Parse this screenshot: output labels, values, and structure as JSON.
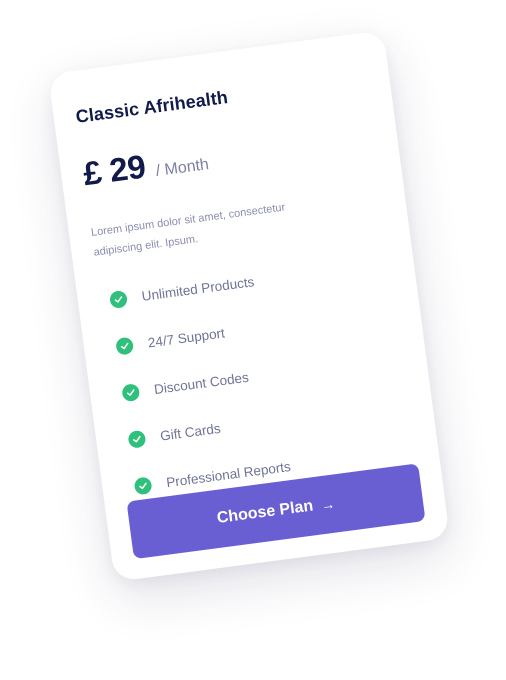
{
  "card": {
    "title": "Classic Afrihealth",
    "price": "£ 29",
    "period": "/ Month",
    "description": "Lorem ipsum dolor sit amet, consectetur adipiscing elit. Ipsum.",
    "features": [
      {
        "label": "Unlimited Products",
        "icon": "check-circle-icon"
      },
      {
        "label": "24/7 Support",
        "icon": "check-circle-icon"
      },
      {
        "label": "Discount Codes",
        "icon": "check-circle-icon"
      },
      {
        "label": "Gift Cards",
        "icon": "check-circle-icon"
      },
      {
        "label": "Professional Reports",
        "icon": "check-circle-icon"
      }
    ],
    "cta": {
      "label": "Choose Plan",
      "arrow": "→",
      "icon": "arrow-right-icon"
    }
  },
  "colors": {
    "title": "#121a4a",
    "muted": "#7c7fa4",
    "check": "#2fc07c",
    "button": "#6a5fd2",
    "button_text": "#ffffff"
  }
}
